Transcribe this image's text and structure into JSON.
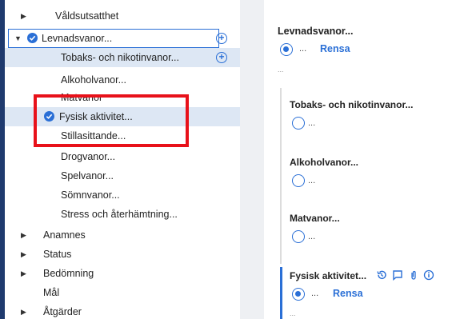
{
  "tree": {
    "items": [
      {
        "label": "Våldsutsatthet"
      },
      {
        "label": "Levnadsvanor..."
      },
      {
        "label": "Tobaks- och nikotinvanor..."
      },
      {
        "label": "Alkoholvanor..."
      },
      {
        "label": "Matvanor"
      },
      {
        "label": "Fysisk aktivitet..."
      },
      {
        "label": "Stillasittande..."
      },
      {
        "label": "Drogvanor..."
      },
      {
        "label": "Spelvanor..."
      },
      {
        "label": "Sömnvanor..."
      },
      {
        "label": "Stress och återhämtning..."
      },
      {
        "label": "Anamnes"
      },
      {
        "label": "Status"
      },
      {
        "label": "Bedömning"
      },
      {
        "label": "Mål"
      },
      {
        "label": "Åtgärder"
      }
    ]
  },
  "panel": {
    "title": "Levnadsvanor...",
    "radio_ellipsis": "...",
    "clear_label": "Rensa",
    "note_ellipsis": "...",
    "sections": [
      {
        "title": "Tobaks- och nikotinvanor...",
        "option": "..."
      },
      {
        "title": "Alkoholvanor...",
        "option": "..."
      },
      {
        "title": "Matvanor...",
        "option": "..."
      },
      {
        "title": "Fysisk aktivitet...",
        "option": "...",
        "clear_label": "Rensa",
        "note": "..."
      }
    ]
  },
  "colors": {
    "accent": "#2a6fd6",
    "highlight": "#dde7f4",
    "annotation": "#e8111a",
    "sidebar": "#1f3a6e"
  }
}
